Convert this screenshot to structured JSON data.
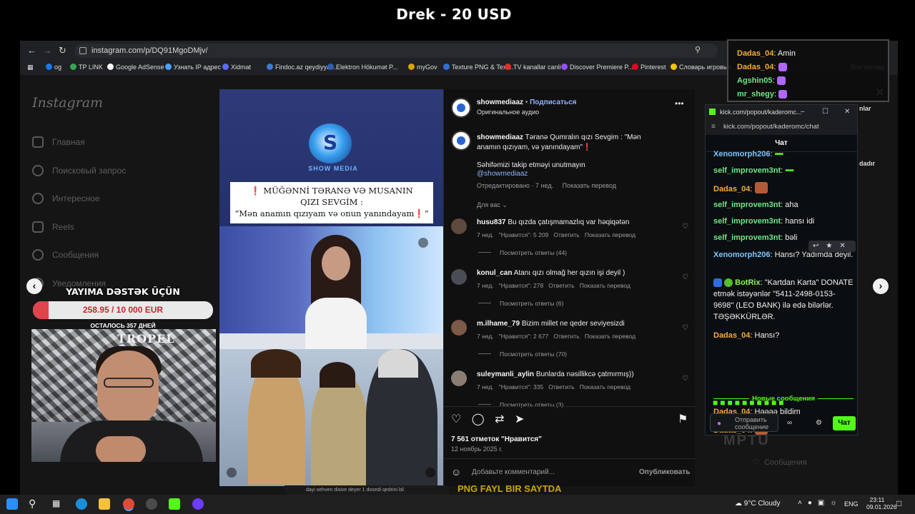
{
  "stream": {
    "title": "Drek - 20 USD"
  },
  "browser": {
    "url": "instagram.com/p/DQ91MgoDMjv/",
    "bookmarks": [
      {
        "label": "og",
        "color": "#1877f2"
      },
      {
        "label": "TP LINK",
        "color": "#34a853"
      },
      {
        "label": "Google AdSense",
        "color": "#ffffff"
      },
      {
        "label": "Узнать IP адрес",
        "color": "#4aa3ff"
      },
      {
        "label": "Xidmat",
        "color": "#5b6bff"
      },
      {
        "label": "Findoc.az qeydiyyat...",
        "color": "#3a7bd5"
      },
      {
        "label": "Elektron Hökumət P...",
        "color": "#2b5fb4"
      },
      {
        "label": "myGov",
        "color": "#d9a400"
      },
      {
        "label": "Texture PNG & Text...",
        "color": "#2f6fd8"
      },
      {
        "label": "TV kanallar canli",
        "color": "#e52d27"
      },
      {
        "label": "Discover Premiere P...",
        "color": "#9b4dff"
      },
      {
        "label": "Pinterest",
        "color": "#e60023"
      },
      {
        "label": "Словарь игровых ...",
        "color": "#f2c500"
      }
    ],
    "all_bookmarks": "Все заклад"
  },
  "instagram": {
    "logo": "Instagram",
    "nav": [
      "Главная",
      "Поисковый запрос",
      "Интересное",
      "Reels",
      "Сообщения",
      "Уведомления"
    ],
    "post": {
      "image_brand": "SHOW MEDIA",
      "image_caption_line1": "MÜĞƏNNİ TƏRANƏ VƏ MUSANIN",
      "image_caption_line2": "QIZI SEVGİM :",
      "image_caption_line3": "“Mən anamın qızıyam və onun yanındayam",
      "author": "showmediaaz",
      "follow": "Подписаться",
      "audio": "Оригинальное аудио",
      "caption_user": "showmediaaz",
      "caption_text": "Təranə Qumralın qızı Sevgim : \"Mən anamın qızıyam, və yanındayam\"",
      "caption_extra": "Səhifəmizi takip etməyi unutmayın",
      "caption_tag": "@showmediaaz",
      "caption_meta": "Отредактировано · 7 нед.",
      "caption_translate": "Показать перевод",
      "sort_label": "Для вас",
      "comments": [
        {
          "user": "husu837",
          "text": "Bu qızda çatışmamazlıq var həqiqətən",
          "age": "7 нед.",
          "likes": "\"Нравится\": 5 209",
          "reply": "Ответить",
          "translate": "Показать перевод",
          "replies": "Посмотреть ответы (44)",
          "avatar": "#5d4a3c"
        },
        {
          "user": "konul_can",
          "text": "Atanı qızı olmağ her qızın işi deyil )",
          "age": "7 нед.",
          "likes": "\"Нравится\": 278",
          "reply": "Ответить",
          "translate": "Показать перевод",
          "replies": "Посмотреть ответы (6)",
          "avatar": "#4a4d55"
        },
        {
          "user": "m.ilhame_79",
          "text": "Bizim millet ne qeder seviyesizdi",
          "age": "7 нед.",
          "likes": "\"Нравится\": 2 677",
          "reply": "Ответить",
          "translate": "Показать перевод",
          "replies": "Посмотреть ответы (70)",
          "avatar": "#7b5a48"
        },
        {
          "user": "suleymanli_aylin",
          "text": "Bunlarda nəsillikcə çatmırmış))",
          "age": "7 нед.",
          "likes": "\"Нравится\": 335",
          "reply": "Ответить",
          "translate": "Показать перевод",
          "replies": "Посмотреть ответы (3)",
          "avatar": "#8a7d72"
        }
      ],
      "likes_total": "7 561 отметок \"Нравится\"",
      "date": "12 ноябрь 2025 г.",
      "add_comment_placeholder": "Добавьте комментарий...",
      "publish": "Опубликовать"
    }
  },
  "overlay": {
    "support_title": "YAYIMA DƏSTƏK ÜÇÜN",
    "goal_text": "258.95 / 10 000 EUR",
    "goal_progress": 0.026,
    "goal_sub": "ОСТАЛОСЬ 357 ДНЕЙ",
    "webcam_sign": "TROPEL"
  },
  "mini_chat": [
    {
      "user": "Dadas_04",
      "text": "Amin",
      "color": "#f4a940"
    },
    {
      "user": "Dadas_04",
      "text": "",
      "color": "#f4a940"
    },
    {
      "user": "Agshin05",
      "text": "",
      "color": "#6ee787"
    },
    {
      "user": "mr_shegy",
      "text": "",
      "color": "#6ee787"
    }
  ],
  "kick": {
    "window_title": "kick.com/popout/kaderomc...",
    "url": "kick.com/popout/kaderomc/chat",
    "header": "Чат",
    "messages": [
      {
        "user": "Xenomorph206",
        "text": "",
        "cls": "u-teal"
      },
      {
        "user": "self_improvem3nt",
        "text": "",
        "cls": "u-green"
      },
      {
        "user": "Dadas_04",
        "text": "",
        "cls": "u-orange",
        "emote": true
      },
      {
        "user": "self_improvem3nt",
        "text": "aha",
        "cls": "u-green"
      },
      {
        "user": "self_improvem3nt",
        "text": "hansı idi",
        "cls": "u-green"
      },
      {
        "user": "self_improvem3nt",
        "text": "bəli",
        "cls": "u-green"
      },
      {
        "user": "Xenomorph206",
        "text": "Hansı? Yadımda deyil.",
        "cls": "u-teal"
      },
      {
        "user": "BotRix",
        "text": "\"Kartdan Karta\" DONATE etmək istəyənlər \"5411-2498-0153-9698\" (LEO BANK) ilə edə bilərlər. TƏŞƏKKÜRLƏR.",
        "cls": "u-lime"
      },
      {
        "user": "Dadas_04",
        "text": "Hansı?",
        "cls": "u-orange"
      }
    ],
    "new_messages": "Новые сообщения",
    "after": [
      {
        "user": "Dadas_04",
        "text": "Həəəə bildim",
        "cls": "u-orange"
      },
      {
        "user": "Dadas_04",
        "text": "",
        "cls": "u-orange",
        "emote": true
      }
    ],
    "input_placeholder": "Отправить сообщение",
    "send": "Чат"
  },
  "background_text": {
    "notifications": "Сообщения",
    "bottom_banner": "PNG FAYL BIR SAYTDA",
    "bottom_small": "dayi sehven disive deyer 1 dosedi qedrini bil",
    "side_text_1": "nlar",
    "side_text_2": "dadır",
    "side_text_3": "MPTU"
  },
  "taskbar": {
    "weather": "9°C  Cloudy",
    "lang": "ENG",
    "time": "23:11",
    "date": "09.01.2026"
  }
}
